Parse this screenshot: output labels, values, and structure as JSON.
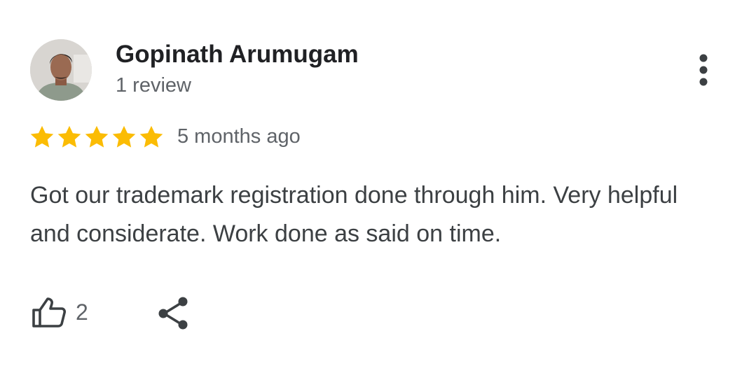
{
  "reviewer": {
    "name": "Gopinath Arumugam",
    "review_count": "1 review",
    "avatar_icon": "person-photo"
  },
  "review": {
    "rating": 5,
    "rating_max": 5,
    "time": "5 months ago",
    "text": "Got our trademark registration done through him. Very helpful and considerate. Work done as said on time."
  },
  "actions": {
    "like_icon": "thumbs-up-icon",
    "like_count": "2",
    "share_icon": "share-icon",
    "more_icon": "more-vert-icon"
  },
  "colors": {
    "star": "#fbbc04",
    "name": "#202124",
    "text": "#3c4043",
    "secondary": "#5f6368"
  }
}
